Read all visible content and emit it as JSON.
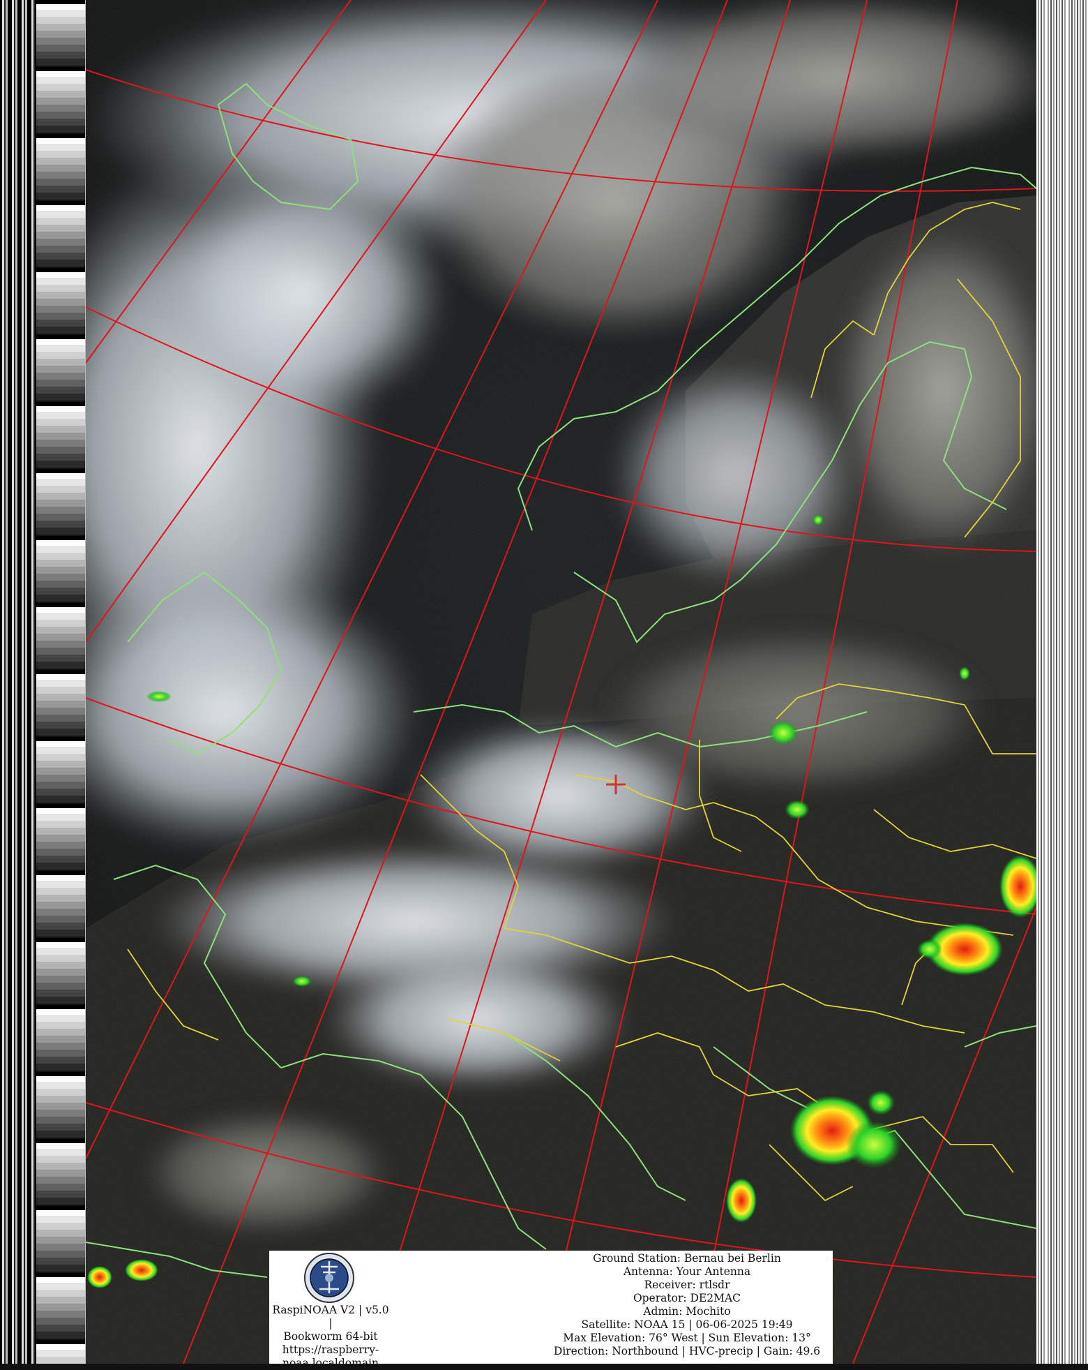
{
  "software": {
    "lines": [
      "RaspiNOAA V2 | v5.0 |",
      "Bookworm 64-bit",
      "https://raspberry-",
      "noaa.localdomain"
    ]
  },
  "station": {
    "lines": [
      "Ground Station: Bernau bei Berlin",
      "Antenna: Your Antenna",
      "Receiver: rtlsdr",
      "Operator: DE2MAC",
      "Admin: Mochito",
      "Satellite: NOAA 15 | 06-06-2025 19:49",
      "Max Elevation: 76° West | Sun Elevation: 13°",
      "Direction: Northbound | HVC-precip | Gain: 49.6"
    ]
  },
  "colors": {
    "graticule": "#e0141e",
    "coastline": "#8ee07e",
    "borders": "#e3d23a",
    "marker": "#d2323c",
    "ocean_dark": "#0c0f0f",
    "cloud": "#dfe6ee"
  },
  "icons": {
    "logo": "station-seal-icon",
    "marker": "station-crosshair-icon"
  }
}
